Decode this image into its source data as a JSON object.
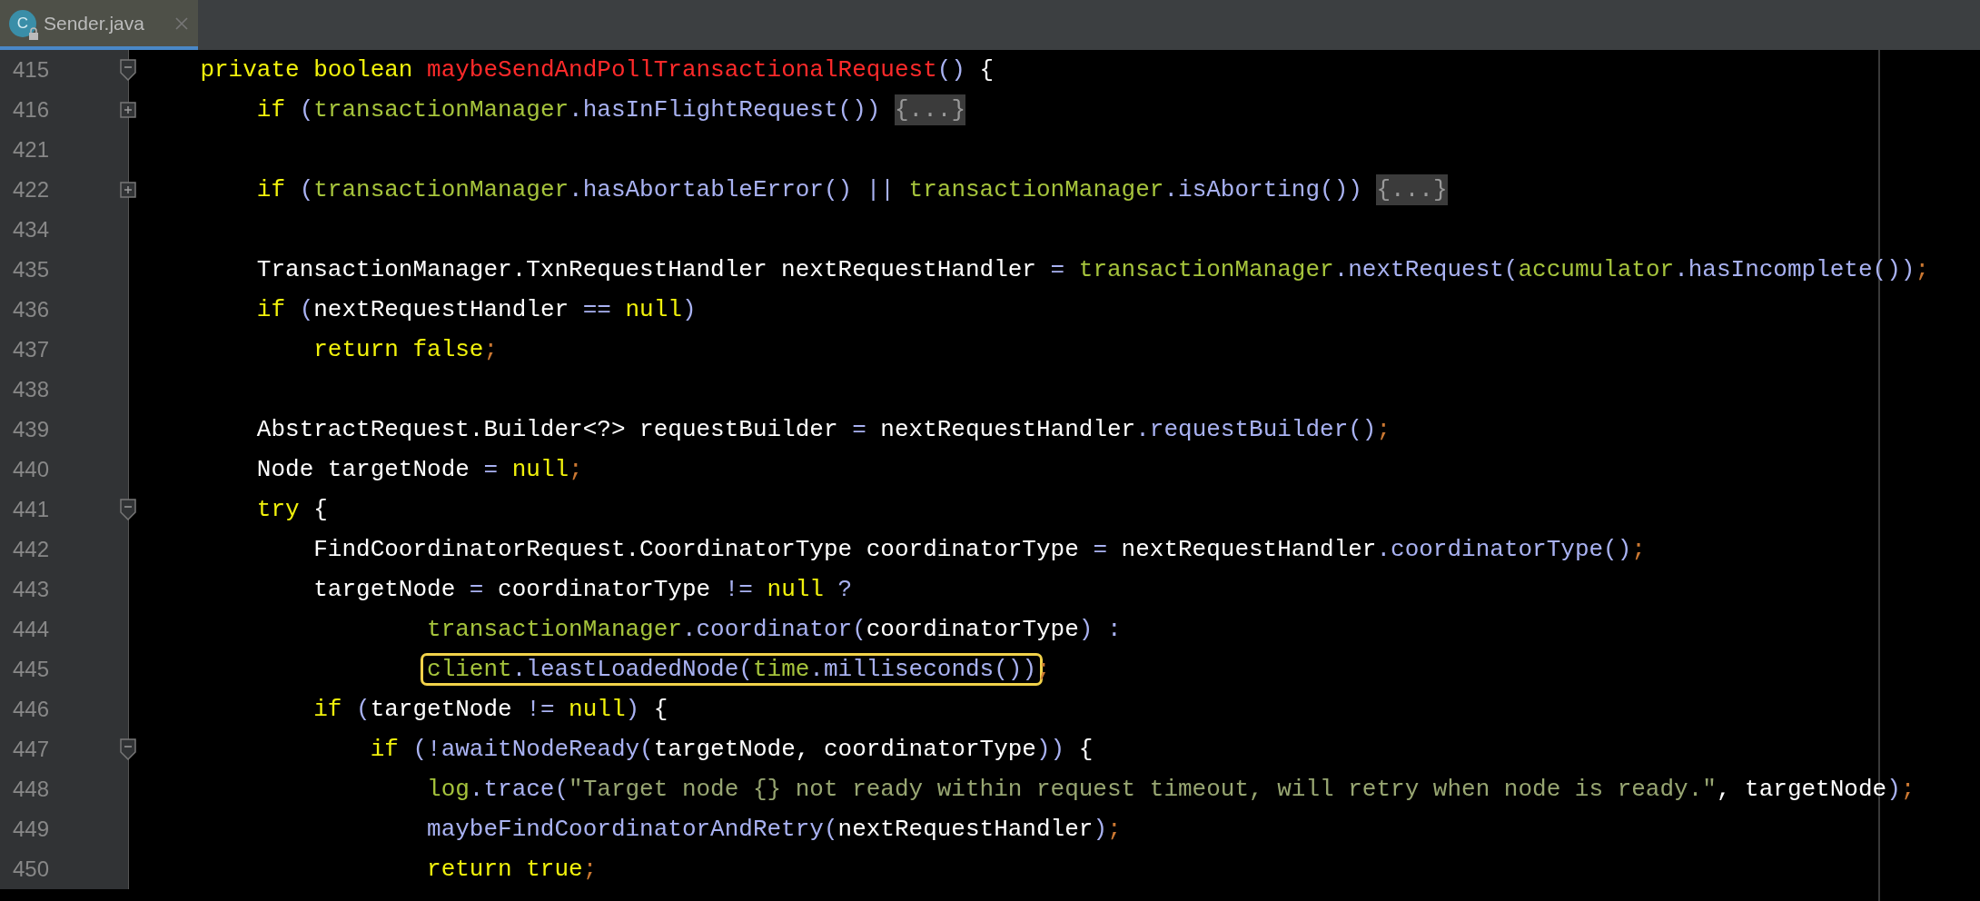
{
  "tabs": [
    {
      "label": "Sender.java",
      "icon_letter": "C",
      "selected": true
    }
  ],
  "editor": {
    "lines": [
      {
        "number": "415",
        "fold_start": true,
        "collapsed": false,
        "segments": [
          {
            "kind": "code",
            "tokens": [
              {
                "t": "    private boolean ",
                "kind": "keyword"
              },
              {
                "t": "maybeSendAndPollTransactionalRequest",
                "kind": "declaration"
              },
              {
                "t": "()",
                "kind": "method"
              },
              {
                "t": " {",
                "kind": "plain"
              }
            ]
          }
        ]
      },
      {
        "number": "416",
        "fold_start": false,
        "collapsed": true,
        "segments": [
          {
            "kind": "code",
            "tokens": [
              {
                "t": "        if ",
                "kind": "keyword"
              },
              {
                "t": "(",
                "kind": "method"
              },
              {
                "t": "transactionManager",
                "kind": "field"
              },
              {
                "t": ".hasInFlightRequest()) ",
                "kind": "method"
              }
            ]
          },
          {
            "kind": "folded",
            "text": "{...}"
          }
        ]
      },
      {
        "number": "421",
        "fold_start": false,
        "collapsed": false
      },
      {
        "number": "422",
        "fold_start": false,
        "collapsed": true,
        "segments": [
          {
            "kind": "code",
            "tokens": [
              {
                "t": "        if ",
                "kind": "keyword"
              },
              {
                "t": "(",
                "kind": "method"
              },
              {
                "t": "transactionManager",
                "kind": "field"
              },
              {
                "t": ".hasAbortableError() || ",
                "kind": "method"
              },
              {
                "t": "transactionManager",
                "kind": "field"
              },
              {
                "t": ".isAborting()) ",
                "kind": "method"
              }
            ]
          },
          {
            "kind": "folded",
            "text": "{...}"
          }
        ]
      },
      {
        "number": "434",
        "fold_start": false,
        "collapsed": false
      },
      {
        "number": "435",
        "fold_start": false,
        "collapsed": false,
        "segments": [
          {
            "kind": "code",
            "tokens": [
              {
                "t": "        TransactionManager.TxnRequestHandler nextRequestHandler ",
                "kind": "plain"
              },
              {
                "t": "= ",
                "kind": "method"
              },
              {
                "t": "transactionManager",
                "kind": "field"
              },
              {
                "t": ".nextRequest(",
                "kind": "method"
              },
              {
                "t": "accumulator",
                "kind": "field"
              },
              {
                "t": ".hasIncomplete())",
                "kind": "method"
              },
              {
                "t": ";",
                "kind": "semicolon"
              }
            ]
          }
        ]
      },
      {
        "number": "436",
        "fold_start": false,
        "collapsed": false,
        "segments": [
          {
            "kind": "code",
            "tokens": [
              {
                "t": "        if ",
                "kind": "keyword"
              },
              {
                "t": "(",
                "kind": "method"
              },
              {
                "t": "nextRequestHandler ",
                "kind": "plain"
              },
              {
                "t": "== ",
                "kind": "method"
              },
              {
                "t": "null",
                "kind": "keyword"
              },
              {
                "t": ")",
                "kind": "method"
              }
            ]
          }
        ]
      },
      {
        "number": "437",
        "fold_start": false,
        "collapsed": false,
        "segments": [
          {
            "kind": "code",
            "tokens": [
              {
                "t": "            return false",
                "kind": "keyword"
              },
              {
                "t": ";",
                "kind": "semicolon"
              }
            ]
          }
        ]
      },
      {
        "number": "438",
        "fold_start": false,
        "collapsed": false
      },
      {
        "number": "439",
        "fold_start": false,
        "collapsed": false,
        "segments": [
          {
            "kind": "code",
            "tokens": [
              {
                "t": "        AbstractRequest.Builder<?> requestBuilder ",
                "kind": "plain"
              },
              {
                "t": "= ",
                "kind": "method"
              },
              {
                "t": "nextRequestHandler",
                "kind": "plain"
              },
              {
                "t": ".requestBuilder()",
                "kind": "method"
              },
              {
                "t": ";",
                "kind": "semicolon"
              }
            ]
          }
        ]
      },
      {
        "number": "440",
        "fold_start": false,
        "collapsed": false,
        "segments": [
          {
            "kind": "code",
            "tokens": [
              {
                "t": "        Node targetNode ",
                "kind": "plain"
              },
              {
                "t": "= ",
                "kind": "method"
              },
              {
                "t": "null",
                "kind": "keyword"
              },
              {
                "t": ";",
                "kind": "semicolon"
              }
            ]
          }
        ]
      },
      {
        "number": "441",
        "fold_start": true,
        "collapsed": false,
        "segments": [
          {
            "kind": "code",
            "tokens": [
              {
                "t": "        try ",
                "kind": "keyword"
              },
              {
                "t": "{",
                "kind": "plain"
              }
            ]
          }
        ]
      },
      {
        "number": "442",
        "fold_start": false,
        "collapsed": false,
        "segments": [
          {
            "kind": "code",
            "tokens": [
              {
                "t": "            FindCoordinatorRequest.CoordinatorType coordinatorType ",
                "kind": "plain"
              },
              {
                "t": "= ",
                "kind": "method"
              },
              {
                "t": "nextRequestHandler",
                "kind": "plain"
              },
              {
                "t": ".coordinatorType()",
                "kind": "method"
              },
              {
                "t": ";",
                "kind": "semicolon"
              }
            ]
          }
        ]
      },
      {
        "number": "443",
        "fold_start": false,
        "collapsed": false,
        "segments": [
          {
            "kind": "code",
            "tokens": [
              {
                "t": "            targetNode ",
                "kind": "plain"
              },
              {
                "t": "= ",
                "kind": "method"
              },
              {
                "t": "coordinatorType ",
                "kind": "plain"
              },
              {
                "t": "!= ",
                "kind": "method"
              },
              {
                "t": "null",
                "kind": "keyword"
              },
              {
                "t": " ?",
                "kind": "method"
              }
            ]
          }
        ]
      },
      {
        "number": "444",
        "fold_start": false,
        "collapsed": false,
        "segments": [
          {
            "kind": "code",
            "tokens": [
              {
                "t": "                    transactionManager",
                "kind": "field"
              },
              {
                "t": ".coordinator(",
                "kind": "method"
              },
              {
                "t": "coordinatorType",
                "kind": "plain"
              },
              {
                "t": ") :",
                "kind": "method"
              }
            ]
          }
        ]
      },
      {
        "number": "445",
        "fold_start": false,
        "collapsed": false,
        "segments": [
          {
            "kind": "highlight",
            "tokens": [
              {
                "t": "                    client",
                "kind": "field"
              },
              {
                "t": ".leastLoadedNode(",
                "kind": "method"
              },
              {
                "t": "time",
                "kind": "field"
              },
              {
                "t": ".milliseconds())",
                "kind": "method"
              }
            ]
          },
          {
            "kind": "code",
            "tokens": [
              {
                "t": ";",
                "kind": "semicolon"
              }
            ]
          }
        ]
      },
      {
        "number": "446",
        "fold_start": false,
        "collapsed": false,
        "segments": [
          {
            "kind": "code",
            "tokens": [
              {
                "t": "            if ",
                "kind": "keyword"
              },
              {
                "t": "(",
                "kind": "method"
              },
              {
                "t": "targetNode ",
                "kind": "plain"
              },
              {
                "t": "!= ",
                "kind": "method"
              },
              {
                "t": "null",
                "kind": "keyword"
              },
              {
                "t": ") ",
                "kind": "method"
              },
              {
                "t": "{",
                "kind": "plain"
              }
            ]
          }
        ]
      },
      {
        "number": "447",
        "fold_start": true,
        "collapsed": false,
        "segments": [
          {
            "kind": "code",
            "tokens": [
              {
                "t": "                if ",
                "kind": "keyword"
              },
              {
                "t": "(!awaitNodeReady(",
                "kind": "method"
              },
              {
                "t": "targetNode, coordinatorType",
                "kind": "plain"
              },
              {
                "t": ")) ",
                "kind": "method"
              },
              {
                "t": "{",
                "kind": "plain"
              }
            ]
          }
        ]
      },
      {
        "number": "448",
        "fold_start": false,
        "collapsed": false,
        "segments": [
          {
            "kind": "code",
            "tokens": [
              {
                "t": "                    log",
                "kind": "field"
              },
              {
                "t": ".trace(",
                "kind": "method"
              },
              {
                "t": "\"Target node {} not ready within request timeout, will retry when node is ready.\"",
                "kind": "string"
              },
              {
                "t": ", targetNode",
                "kind": "plain"
              },
              {
                "t": ")",
                "kind": "method"
              },
              {
                "t": ";",
                "kind": "semicolon"
              }
            ]
          }
        ]
      },
      {
        "number": "449",
        "fold_start": false,
        "collapsed": false,
        "segments": [
          {
            "kind": "code",
            "tokens": [
              {
                "t": "                    maybeFindCoordinatorAndRetry(",
                "kind": "method"
              },
              {
                "t": "nextRequestHandler",
                "kind": "plain"
              },
              {
                "t": ")",
                "kind": "method"
              },
              {
                "t": ";",
                "kind": "semicolon"
              }
            ]
          }
        ]
      },
      {
        "number": "450",
        "fold_start": false,
        "collapsed": false,
        "segments": [
          {
            "kind": "code",
            "tokens": [
              {
                "t": "                    return true",
                "kind": "keyword"
              },
              {
                "t": ";",
                "kind": "semicolon"
              }
            ]
          }
        ]
      }
    ]
  }
}
